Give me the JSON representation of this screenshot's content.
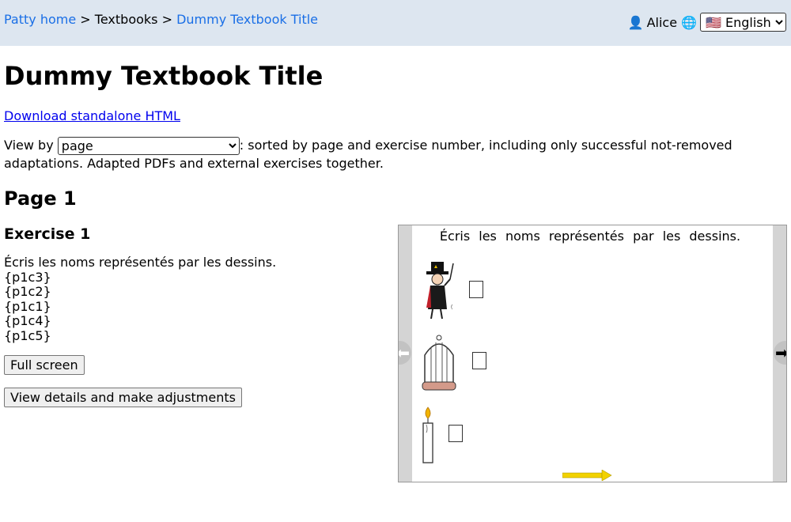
{
  "breadcrumb": {
    "home": "Patty home",
    "sep1": ">",
    "textbooks": "Textbooks",
    "sep2": ">",
    "current": "Dummy Textbook Title"
  },
  "user": {
    "icon": "person-icon",
    "name": "Alice",
    "globe_icon": "globe-icon"
  },
  "language": {
    "selected": "🇺🇸 English"
  },
  "page_title": "Dummy Textbook Title",
  "download_link": "Download standalone HTML",
  "view_by": {
    "label": "View by",
    "selected": "page",
    "description": ": sorted by page and exercise number, including only successful not-removed adaptations. Adapted PDFs and external exercises together."
  },
  "page_heading": "Page 1",
  "exercise": {
    "heading": "Exercise 1",
    "instruction": "Écris les noms représentés par les dessins.",
    "placeholders": [
      "{p1c3}",
      "{p1c2}",
      "{p1c1}",
      "{p1c4}",
      "{p1c5}"
    ],
    "fullscreen_button": "Full screen",
    "details_button": "View details and make adjustments"
  },
  "viewer": {
    "instruction": "Écris les noms représentés par les dessins.",
    "prev_icon": "arrow-left-icon",
    "next_icon": "arrow-right-icon",
    "colors": {
      "nav_strip": "#d4d4d4",
      "arrow": "#f2d200"
    }
  }
}
